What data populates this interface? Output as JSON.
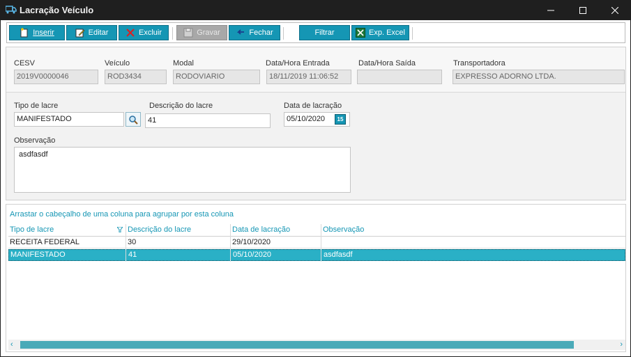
{
  "window": {
    "title": "Lacração Veículo"
  },
  "toolbar": {
    "inserir": "Inserir",
    "editar": "Editar",
    "excluir": "Excluir",
    "gravar": "Gravar",
    "fechar": "Fechar",
    "filtrar": "Filtrar",
    "exp_excel": "Exp. Excel"
  },
  "header": {
    "cesv_label": "CESV",
    "cesv_value": "2019V0000046",
    "veiculo_label": "Veículo",
    "veiculo_value": "ROD3434",
    "modal_label": "Modal",
    "modal_value": "RODOVIARIO",
    "entrada_label": "Data/Hora Entrada",
    "entrada_value": "18/11/2019 11:06:52",
    "saida_label": "Data/Hora Saída",
    "saida_value": "",
    "transp_label": "Transportadora",
    "transp_value": "EXPRESSO ADORNO LTDA."
  },
  "form": {
    "tipo_label": "Tipo de lacre",
    "tipo_value": "MANIFESTADO",
    "desc_label": "Descrição do lacre",
    "desc_value": "41",
    "data_label": "Data de lacração",
    "data_value": "05/10/2020",
    "calendar_day": "15",
    "obs_label": "Observação",
    "obs_value": "asdfasdf"
  },
  "grid": {
    "group_hint": "Arrastar o cabeçalho de uma coluna para agrupar por esta coluna",
    "columns": [
      "Tipo de lacre",
      "Descrição do lacre",
      "Data de lacração",
      "Observação"
    ],
    "rows": [
      [
        "RECEITA FEDERAL",
        "30",
        "29/10/2020",
        ""
      ],
      [
        "MANIFESTADO",
        "41",
        "05/10/2020",
        "asdfasdf"
      ]
    ],
    "selected_row": 1
  },
  "colors": {
    "accent": "#1596b4",
    "selected_row": "#2ab0c6",
    "titlebar": "#1f1f1f"
  },
  "icons": [
    "truck-icon",
    "insert-icon",
    "edit-icon",
    "delete-icon",
    "save-icon",
    "close-icon",
    "filter",
    "excel-icon",
    "search-icon",
    "calendar-icon",
    "filter-icon"
  ]
}
